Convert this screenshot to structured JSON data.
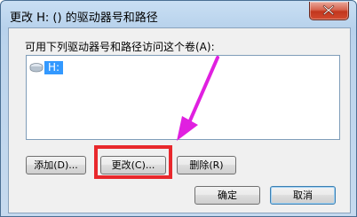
{
  "window": {
    "title": "更改 H: () 的驱动器号和路径",
    "close_icon": "close-icon"
  },
  "dialog": {
    "caption": "可用下列驱动器号和路径访问这个卷(A):",
    "items": [
      {
        "label": "H:",
        "icon": "drive-icon",
        "selected": true
      }
    ]
  },
  "buttons": {
    "add": "添加(D)...",
    "change": "更改(C)...",
    "remove": "删除(R)",
    "ok": "确定",
    "cancel": "取消"
  },
  "annotations": {
    "highlight_color": "#e8282c",
    "arrow_color": "#e020e0"
  }
}
